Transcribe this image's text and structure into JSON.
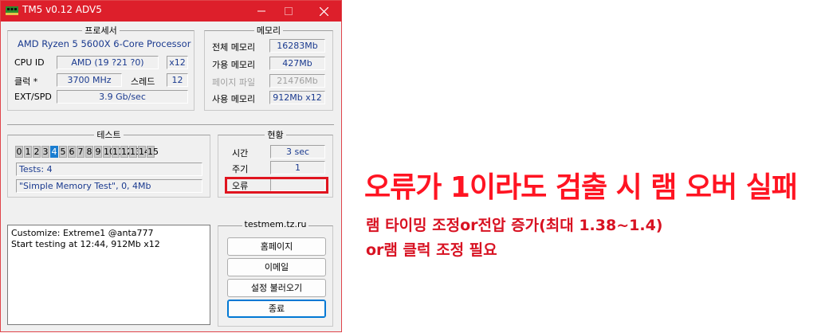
{
  "window": {
    "title": "TM5 v0.12 ADV5"
  },
  "processor": {
    "title": "프로세서",
    "name": "AMD Ryzen 5 5600X 6-Core Processor",
    "cpu_id_label": "CPU ID",
    "cpu_id_value": "AMD  (19 ?21 ?0)",
    "cpu_id_count": "x12",
    "clock_label": "클럭 *",
    "clock_value": "3700 MHz",
    "threads_label": "스레드",
    "threads_value": "12",
    "ext_label": "EXT/SPD",
    "ext_value": "3.9 Gb/sec"
  },
  "memory": {
    "title": "메모리",
    "total_label": "전체 메모리",
    "total_value": "16283Mb",
    "avail_label": "가용 메모리",
    "avail_value": "427Mb",
    "page_label": "페이지 파일",
    "page_value": "21476Mb",
    "used_label": "사용 메모리",
    "used_value": "912Mb x12"
  },
  "test": {
    "title": "테스트",
    "cells": [
      "0",
      "1",
      "2",
      "3",
      "4",
      "5",
      "6",
      "7",
      "8",
      "9",
      "10",
      "11",
      "12",
      "13",
      "14",
      "15"
    ],
    "active_cell": 4,
    "tests_text": "Tests: 4",
    "current_text": "\"Simple Memory Test\", 0, 4Mb"
  },
  "status": {
    "title": "현황",
    "time_label": "시간",
    "time_value": "3 sec",
    "cycle_label": "주기",
    "cycle_value": "1",
    "error_label": "오류",
    "error_value": ""
  },
  "log": {
    "lines": [
      "Customize: Extreme1 @anta777",
      "Start testing at 12:44, 912Mb x12"
    ]
  },
  "links": {
    "site": "testmem.tz.ru",
    "homepage": "홈페이지",
    "email": "이메일",
    "load_settings": "설정 불러오기",
    "exit": "종료"
  },
  "caption": {
    "headline": "오류가 1이라도 검출 시 램 오버 실패",
    "line1": "램 타이밍 조정or전압 증가(최대 1.38~1.4)",
    "line2": "or램 클럭 조정 필요"
  },
  "colors": {
    "titlebar": "#dd1f2b",
    "highlight": "#e0141f",
    "caption": "#ff1422",
    "value_text": "#1a3a8f"
  }
}
